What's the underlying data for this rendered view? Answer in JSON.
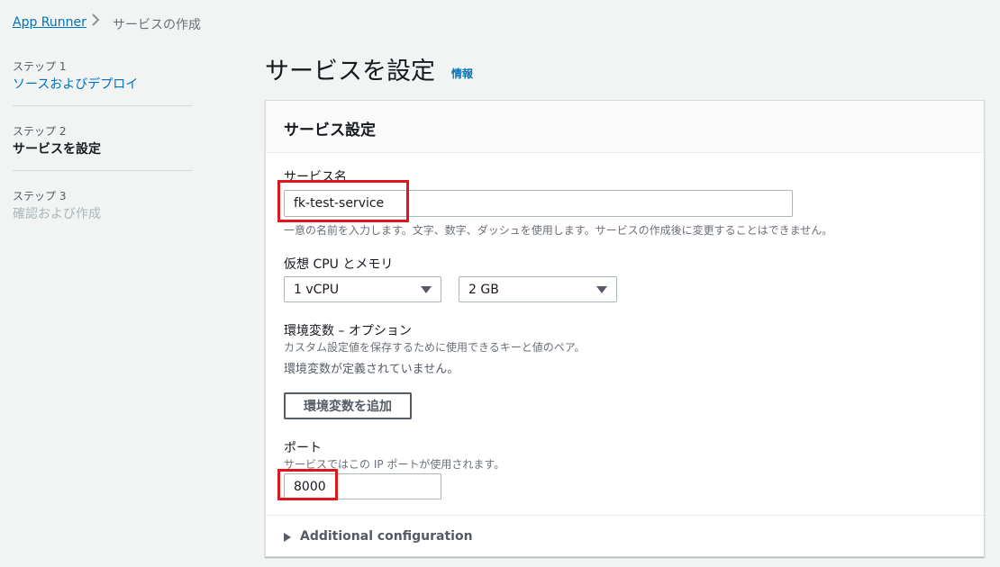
{
  "breadcrumb": {
    "root": "App Runner",
    "current": "サービスの作成"
  },
  "steps": [
    {
      "label": "ステップ 1",
      "title": "ソースおよびデプロイ"
    },
    {
      "label": "ステップ 2",
      "title": "サービスを設定"
    },
    {
      "label": "ステップ 3",
      "title": "確認および作成"
    }
  ],
  "page": {
    "title": "サービスを設定",
    "info": "情報"
  },
  "panel": {
    "title": "サービス設定",
    "service_name": {
      "label": "サービス名",
      "value": "fk-test-service",
      "description": "一意の名前を入力します。文字、数字、ダッシュを使用します。サービスの作成後に変更することはできません。"
    },
    "vcpu_memory": {
      "label": "仮想 CPU とメモリ",
      "cpu": "1 vCPU",
      "memory": "2 GB"
    },
    "env": {
      "label": "環境変数 – オプション",
      "description": "カスタム設定値を保存するために使用できるキーと値のペア。",
      "empty": "環境変数が定義されていません。",
      "add_button": "環境変数を追加"
    },
    "port": {
      "label": "ポート",
      "description": "サービスではこの IP ポートが使用されます。",
      "value": "8000"
    },
    "additional": "Additional configuration"
  },
  "colors": {
    "accent_link": "#0073bb",
    "highlight": "#e0161f",
    "background": "#f2f3f3"
  }
}
